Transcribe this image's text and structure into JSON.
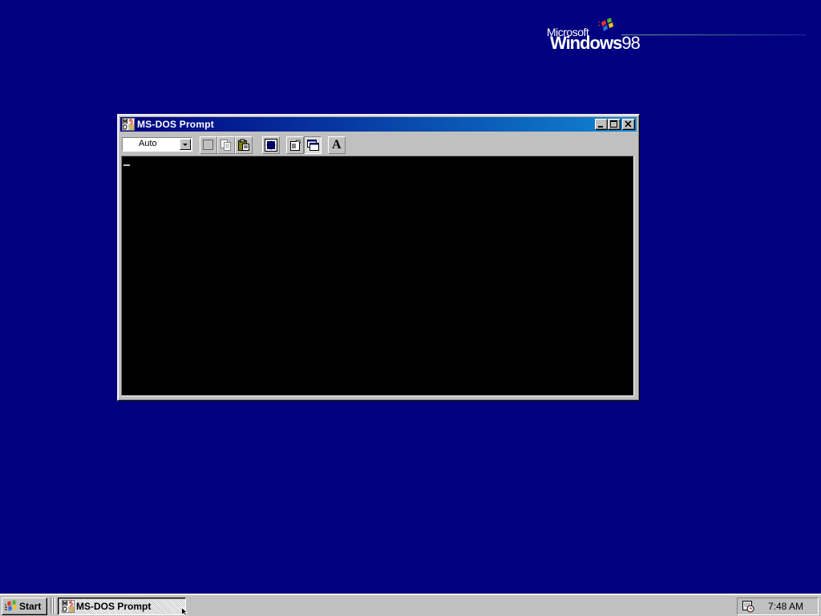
{
  "desktop": {
    "background_color": "#000080",
    "logo": {
      "brand": "Microsoft",
      "product": "Windows",
      "version": "98"
    }
  },
  "window": {
    "title": "MS-DOS Prompt",
    "icon": "ms-dos-icon",
    "controls": [
      "minimize-icon",
      "maximize-icon",
      "close-icon"
    ],
    "toolbar": {
      "font_size_value": "Auto",
      "tools": [
        {
          "name": "mark",
          "icon": "mark-icon",
          "state": "raised"
        },
        {
          "name": "copy",
          "icon": "copy-icon",
          "state": "disabled"
        },
        {
          "name": "paste",
          "icon": "paste-icon",
          "state": "raised"
        },
        {
          "name": "full-screen",
          "icon": "full-screen-icon",
          "state": "raised"
        },
        {
          "name": "properties",
          "icon": "properties-icon",
          "state": "raised"
        },
        {
          "name": "background",
          "icon": "background-icon",
          "state": "pressed"
        },
        {
          "name": "font",
          "icon": "font-icon",
          "glyph": "A",
          "state": "raised"
        }
      ]
    },
    "console": {
      "background": "#000000",
      "cursor_char": "_"
    }
  },
  "taskbar": {
    "start_label": "Start",
    "task_button_label": "MS-DOS Prompt",
    "clock": "7:48 AM"
  }
}
